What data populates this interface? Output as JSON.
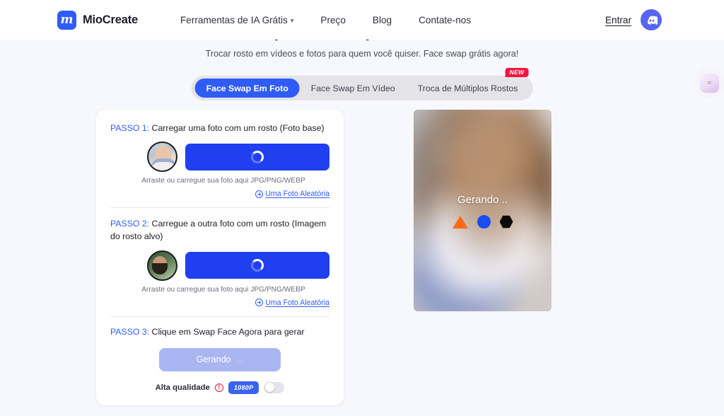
{
  "header": {
    "logo_text": "MioCreate",
    "logo_glyph": "m",
    "nav": [
      {
        "label": "Ferramentas de IA Grátis",
        "has_chevron": true,
        "chevron": "⌄"
      },
      {
        "label": "Preço",
        "has_chevron": false
      },
      {
        "label": "Blog",
        "has_chevron": false
      },
      {
        "label": "Contate-nos",
        "has_chevron": false
      }
    ],
    "login_label": "Entrar",
    "discord_icon": "discord-icon"
  },
  "hero": {
    "title": "Face Swap IA Grátis para Fotos e Vídeos",
    "subtitle": "Trocar rosto em vídeos e fotos para quem você quiser. Face swap grátis agora!"
  },
  "tabs": {
    "items": [
      {
        "label": "Face Swap Em Foto",
        "active": true,
        "badge": null
      },
      {
        "label": "Face Swap Em Vídeo",
        "active": false,
        "badge": null
      },
      {
        "label": "Troca de Múltiplos Rostos",
        "active": false,
        "badge": "NEW"
      }
    ]
  },
  "card": {
    "step1": {
      "prefix": "PASSO 1:",
      "text": " Carregar uma foto com um rosto (Foto base)",
      "hint": "Arraste ou carregue sua foto aqui JPG/PNG/WEBP",
      "random_link": "Uma Foto Aleatória",
      "button_state": "loading"
    },
    "step2": {
      "prefix": "PASSO 2:",
      "text": " Carregue a outra foto com um rosto (Imagem do rosto alvo)",
      "hint": "Arraste ou carregue sua foto aqui JPG/PNG/WEBP",
      "random_link": "Uma Foto Aleatória",
      "button_state": "loading"
    },
    "step3": {
      "prefix": "PASSO 3:",
      "text": " Clique em Swap Face Agora para gerar",
      "generate_label": "Gerando",
      "generate_dots": "..",
      "quality_label": "Alta qualidade",
      "warn_glyph": "!",
      "resolution_badge": "1080P",
      "toggle_state": "off"
    }
  },
  "result": {
    "status_text": "Gerando ..",
    "shapes": [
      "triangle",
      "circle",
      "hexagon"
    ],
    "shape_colors": {
      "triangle": "#ff6a1a",
      "circle": "#1b4df0",
      "hexagon": "#0a0a0a"
    }
  },
  "floating_widget": {
    "icon": "face-widget-icon",
    "glyph": "≈"
  },
  "colors": {
    "brand_blue": "#2f5cf5",
    "button_blue": "#1f3ff0",
    "disabled_blue": "#aab6f2",
    "badge_red": "#f5143c",
    "page_bg": "#f7f8fd",
    "discord": "#5865f2"
  }
}
